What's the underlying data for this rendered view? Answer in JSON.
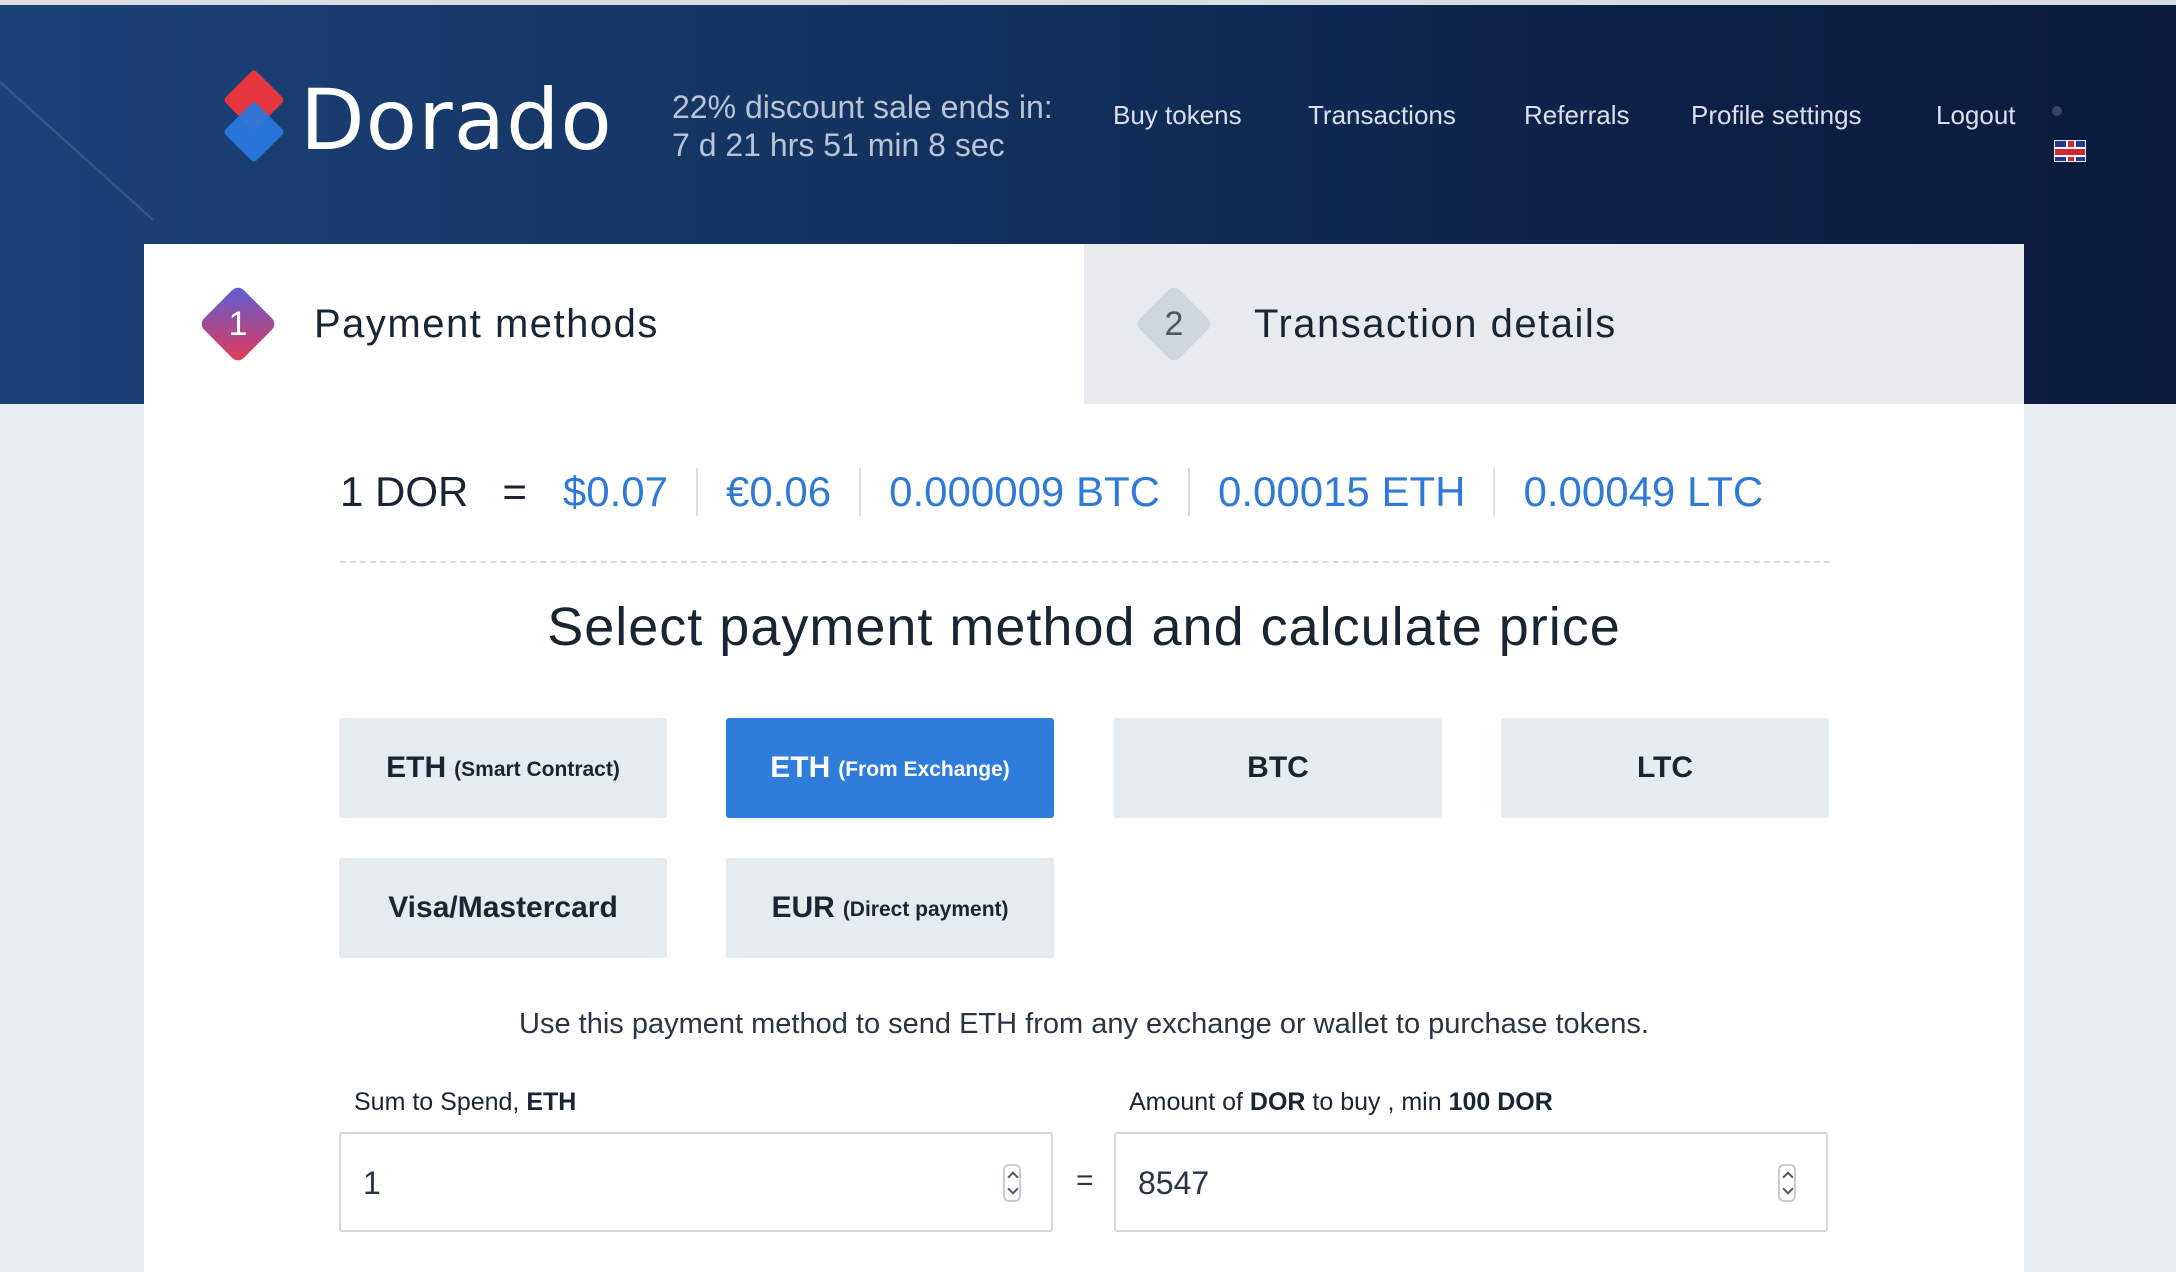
{
  "header": {
    "logo_text": "Dorado",
    "sale_title": "22% discount sale ends in:",
    "sale_countdown": "7 d 21 hrs 51 min 8 sec",
    "nav": [
      "Buy tokens",
      "Transactions",
      "Referrals",
      "Profile settings",
      "Logout"
    ],
    "language_icon": "uk-flag-icon"
  },
  "tabs": [
    {
      "number": "1",
      "label": "Payment methods",
      "active": true
    },
    {
      "number": "2",
      "label": "Transaction details",
      "active": false
    }
  ],
  "rates": {
    "lhs": "1 DOR",
    "eq": "=",
    "values": [
      "$0.07",
      "€0.06",
      "0.000009 BTC",
      "0.00015 ETH",
      "0.00049 LTC"
    ]
  },
  "headline": "Select payment method and calculate price",
  "payment_methods": [
    {
      "main": "ETH",
      "sub": "(Smart Contract)",
      "active": false
    },
    {
      "main": "ETH",
      "sub": "(From Exchange)",
      "active": true
    },
    {
      "main": "BTC",
      "sub": "",
      "active": false
    },
    {
      "main": "LTC",
      "sub": "",
      "active": false
    },
    {
      "main": "Visa/Mastercard",
      "sub": "",
      "active": false
    },
    {
      "main": "EUR",
      "sub": "(Direct payment)",
      "active": false
    }
  ],
  "hint": "Use this payment method to send ETH from any exchange or wallet to purchase tokens.",
  "calculator": {
    "spend_label_prefix": "Sum to Spend, ",
    "spend_label_currency": "ETH",
    "spend_value": "1",
    "amount_label_prefix": "Amount of ",
    "amount_label_token": "DOR",
    "amount_label_middle": " to buy , min ",
    "amount_label_min": "100 DOR",
    "amount_value": "8547",
    "eq": "="
  },
  "colors": {
    "accent": "#2f7ddb",
    "header_dark": "#0d2148"
  }
}
